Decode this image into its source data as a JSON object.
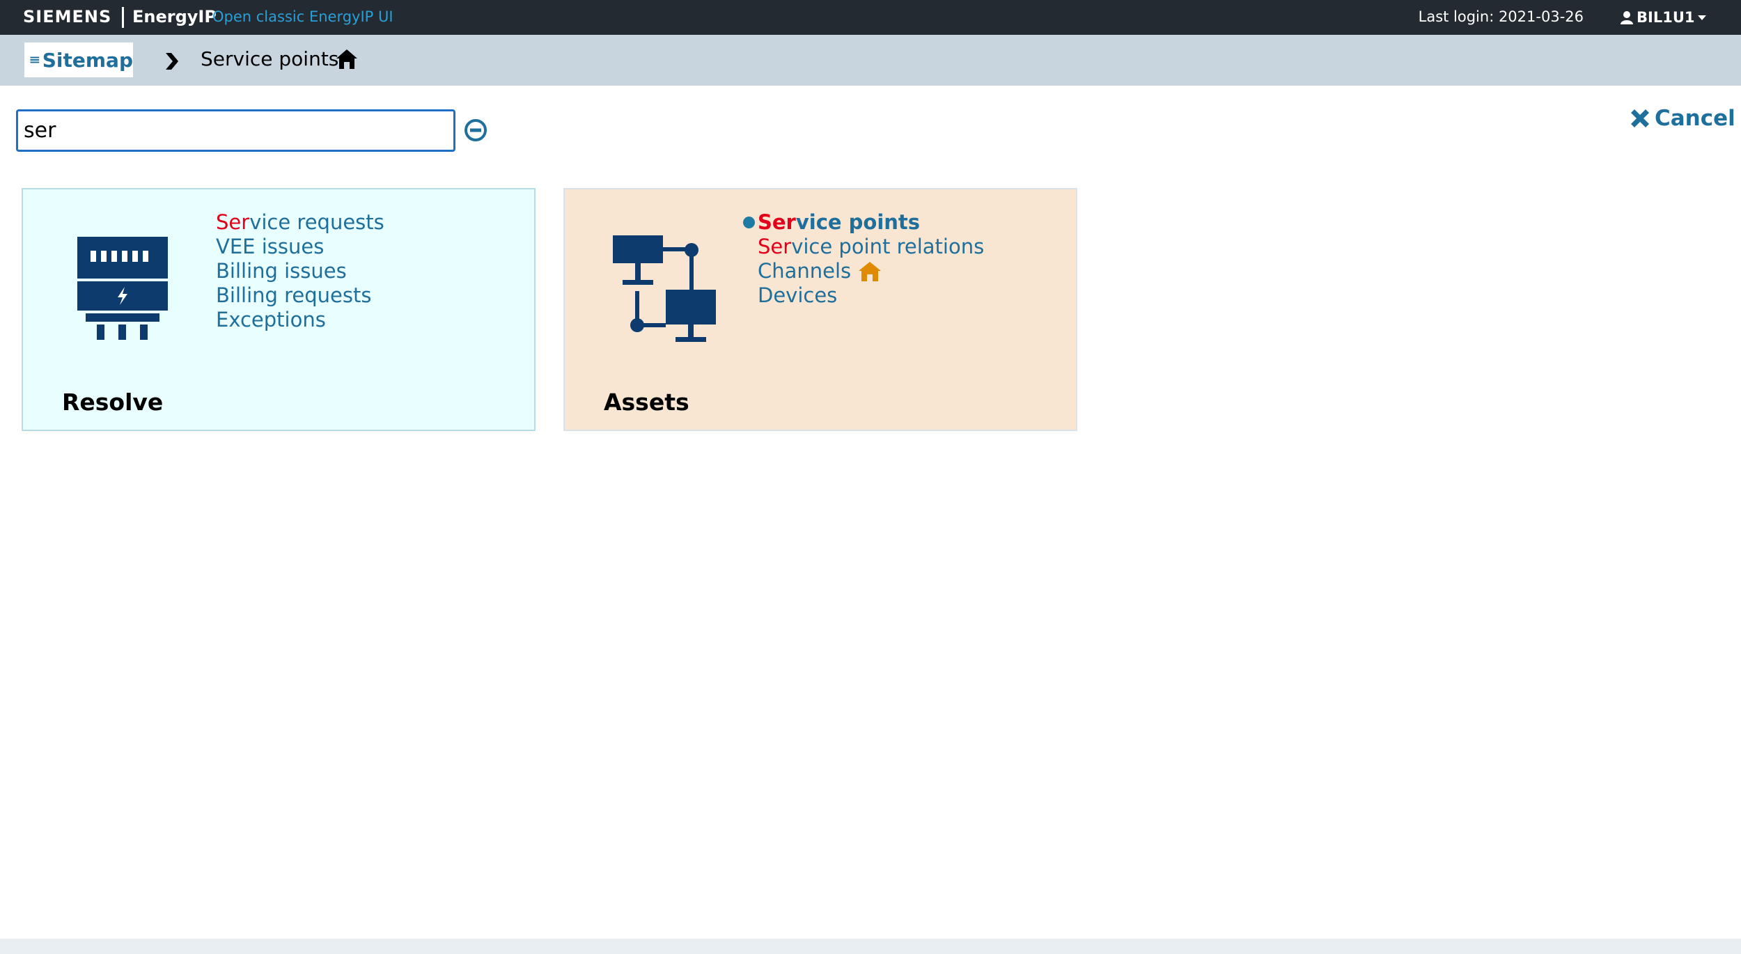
{
  "header": {
    "brand": "SIEMENS",
    "product": "EnergyIP",
    "classic_link": "Open classic EnergyIP UI",
    "last_login": "Last login: 2021-03-26",
    "user": "BIL1U1"
  },
  "breadcrumb": {
    "sitemap_label": "Sitemap",
    "current": "Service points"
  },
  "search": {
    "value": "ser",
    "placeholder": ""
  },
  "actions": {
    "cancel_label": "Cancel"
  },
  "cards": [
    {
      "title": "Resolve",
      "icon": "meter-icon",
      "background": "#e8feff",
      "items": [
        {
          "highlight": "Ser",
          "rest": "vice requests",
          "active": false
        },
        {
          "highlight": "",
          "rest": "VEE issues",
          "active": false
        },
        {
          "highlight": "",
          "rest": "Billing issues",
          "active": false
        },
        {
          "highlight": "",
          "rest": "Billing requests",
          "active": false
        },
        {
          "highlight": "",
          "rest": "Exceptions",
          "active": false
        }
      ]
    },
    {
      "title": "Assets",
      "icon": "network-icon",
      "background": "#f8e6d2",
      "items": [
        {
          "highlight": "Ser",
          "rest": "vice points",
          "active": true
        },
        {
          "highlight": "Ser",
          "rest": "vice point relations",
          "active": false
        },
        {
          "highlight": "",
          "rest": "Channels",
          "active": false,
          "home": true
        },
        {
          "highlight": "",
          "rest": "Devices",
          "active": false
        }
      ]
    }
  ],
  "colors": {
    "topbar": "#232a31",
    "crumbbar": "#c8d5de",
    "link": "#1f6f9d",
    "highlight": "#e2001a",
    "home_orange": "#e08a00",
    "icon_navy": "#0d3b6e"
  }
}
